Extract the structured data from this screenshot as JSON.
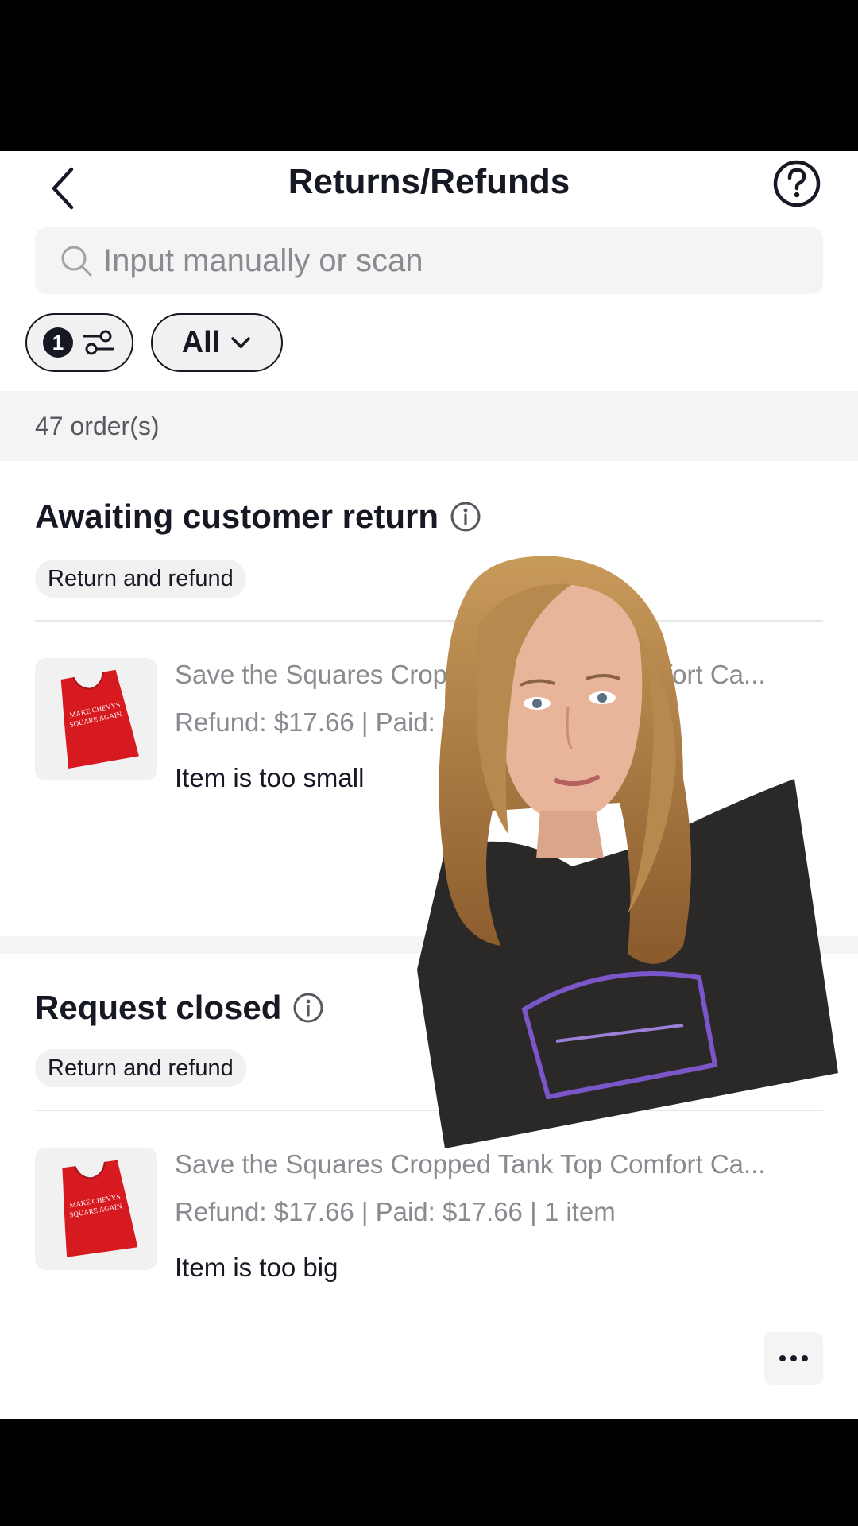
{
  "header": {
    "title": "Returns/Refunds"
  },
  "search": {
    "placeholder": "Input manually or scan"
  },
  "filters": {
    "badge_count": "1",
    "status_label": "All"
  },
  "orders": {
    "count_label": "47 order(s)"
  },
  "sections": [
    {
      "title": "Awaiting customer return",
      "tag": "Return and refund",
      "item": {
        "name": "Save the Squares Cropped Tank Top Comfort Ca...",
        "price_line": "Refund: $17.66 | Paid: $17.66 | 1 item",
        "reason": "Item is too small",
        "print_text": "MAKE CHEVYS SQUARE AGAIN"
      }
    },
    {
      "title": "Request closed",
      "tag": "Return and refund",
      "item": {
        "name": "Save the Squares Cropped Tank Top Comfort Ca...",
        "price_line": "Refund: $17.66 | Paid: $17.66 | 1 item",
        "reason": "Item is too big",
        "print_text": "MAKE CHEVYS SQUARE AGAIN"
      }
    }
  ],
  "colors": {
    "text": "#161823",
    "muted": "#8a8b91",
    "product_red": "#d71920",
    "gap_gray": "#f4f4f5"
  },
  "icons": [
    "back-arrow-icon",
    "help-icon",
    "search-icon",
    "filter-sliders-icon",
    "chevron-down-icon",
    "info-icon",
    "more-icon"
  ]
}
